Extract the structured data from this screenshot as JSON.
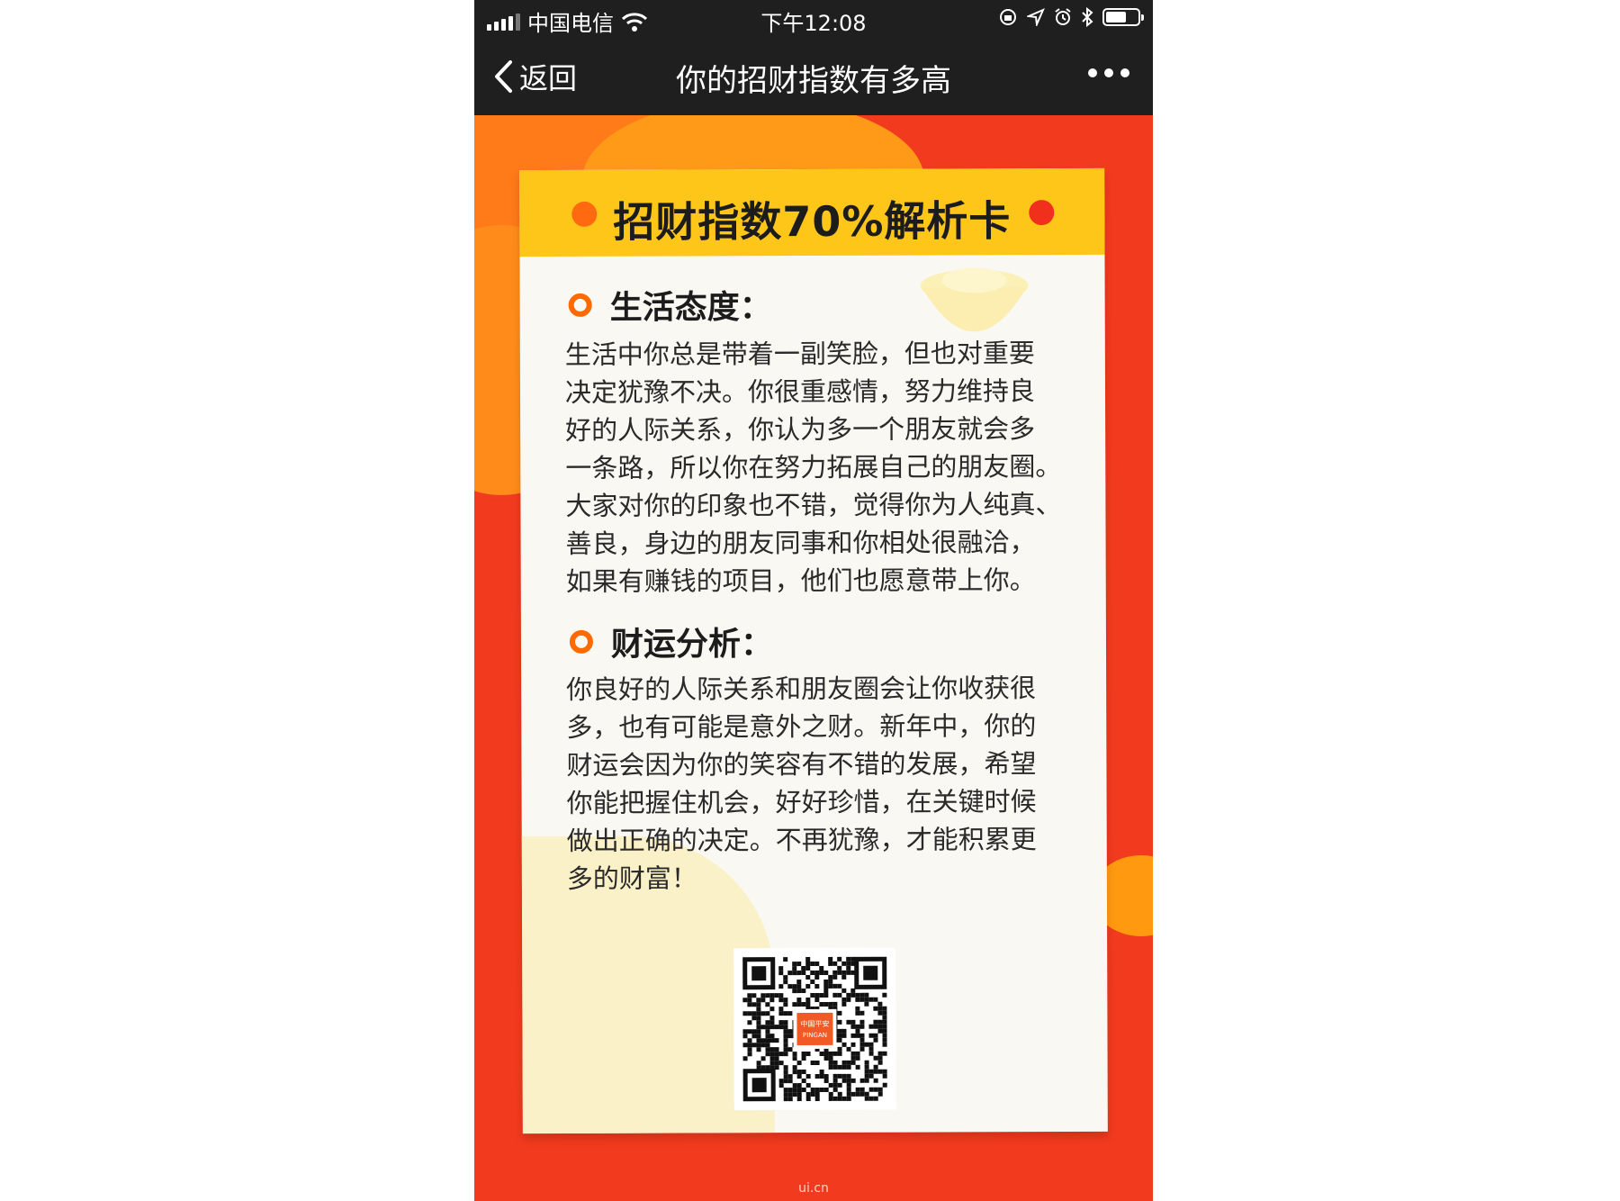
{
  "status_bar": {
    "carrier": "中国电信",
    "time": "下午12:08",
    "icons": [
      "signal-icon",
      "wifi-icon",
      "rotation-lock-icon",
      "location-icon",
      "alarm-icon",
      "bluetooth-icon",
      "battery-icon"
    ]
  },
  "nav": {
    "back_label": "返回",
    "title": "你的招财指数有多高",
    "more_icon": "more-icon"
  },
  "card": {
    "title": "招财指数70%解析卡",
    "sections": [
      {
        "heading": "生活态度：",
        "lines": [
          "生活中你总是带着一副笑脸，但也对重要",
          "决定犹豫不决。你很重感情，努力维持良",
          "好的人际关系，你认为多一个朋友就会多",
          "一条路，所以你在努力拓展自己的朋友圈。",
          "大家对你的印象也不错，觉得你为人纯真、",
          "善良，身边的朋友同事和你相处很融洽，",
          "如果有赚钱的项目，他们也愿意带上你。"
        ]
      },
      {
        "heading": "财运分析：",
        "lines": [
          "你良好的人际关系和朋友圈会让你收获很",
          "多，也有可能是意外之财。新年中，你的",
          "财运会因为你的笑容有不错的发展，希望",
          "你能把握住机会，好好珍惜，在关键时候",
          "做出正确的决定。不再犹豫，才能积累更",
          "多的财富！"
        ]
      }
    ],
    "qr_logo_text": "中国平安",
    "qr_logo_sub": "PINGAN"
  },
  "watermark": "ui.cn",
  "colors": {
    "background": "#f23a1e",
    "header_yellow": "#ffc61a",
    "accent_orange": "#ff6a00",
    "dot_red": "#f0301c",
    "bar_dark": "#1f1f1f"
  }
}
